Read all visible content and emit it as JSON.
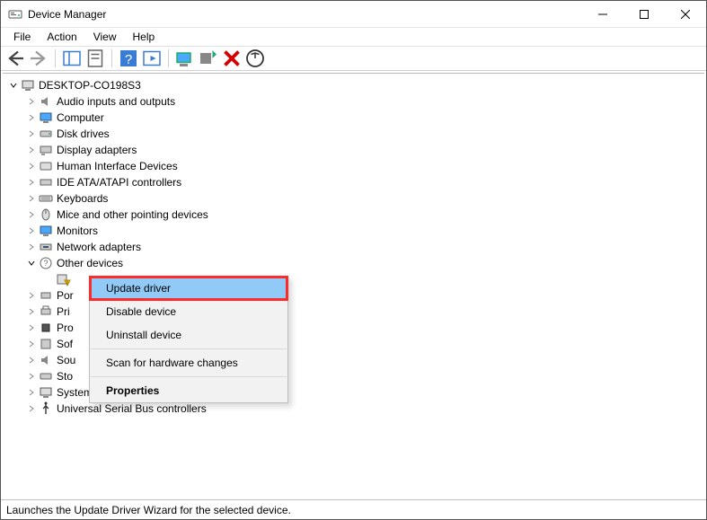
{
  "titlebar": {
    "title": "Device Manager"
  },
  "menubar": [
    "File",
    "Action",
    "View",
    "Help"
  ],
  "root_label": "DESKTOP-CO198S3",
  "categories": [
    "Audio inputs and outputs",
    "Computer",
    "Disk drives",
    "Display adapters",
    "Human Interface Devices",
    "IDE ATA/ATAPI controllers",
    "Keyboards",
    "Mice and other pointing devices",
    "Monitors",
    "Network adapters",
    "Other devices"
  ],
  "other_devices_children_partial": [
    "Por",
    "Pri",
    "Pro",
    "Sof",
    "Sou",
    "Sto"
  ],
  "post_categories": [
    "System devices",
    "Universal Serial Bus controllers"
  ],
  "context_menu": {
    "update": "Update driver",
    "disable": "Disable device",
    "uninstall": "Uninstall device",
    "scan": "Scan for hardware changes",
    "properties": "Properties"
  },
  "statusbar": "Launches the Update Driver Wizard for the selected device."
}
